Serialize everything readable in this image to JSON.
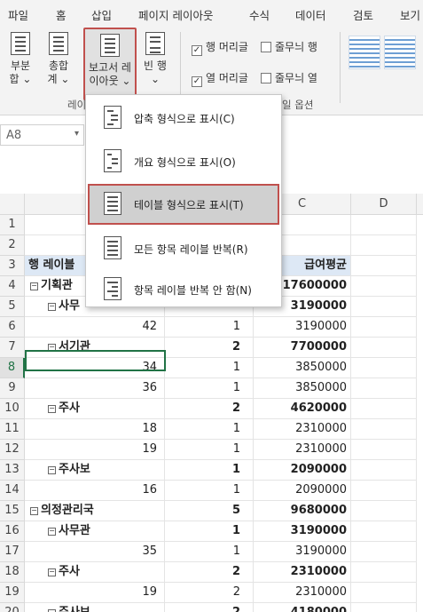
{
  "menubar": {
    "tabs": [
      "파일",
      "홈",
      "삽입",
      "페이지 레이아웃",
      "수식",
      "데이터",
      "검토",
      "보기"
    ]
  },
  "ribbon": {
    "subtotal": {
      "line1": "부분",
      "line2": "합 ⌄"
    },
    "grandtotal": {
      "line1": "총합",
      "line2": "계 ⌄"
    },
    "report_layout": {
      "line1": "보고서 레",
      "line2": "이아웃 ⌄"
    },
    "blank_rows": {
      "line1": "빈 행",
      "line2": "⌄"
    },
    "group_label_layout": "레이",
    "options": {
      "row_headers": "행 머리글",
      "col_headers": "열 머리글",
      "banded_rows": "줄무늬 행",
      "banded_cols": "줄무늬 열",
      "group_label": "일 옵션"
    }
  },
  "namebox": {
    "value": "A8",
    "arrow": "▾"
  },
  "dropdown": {
    "items": [
      "압축 형식으로 표시(C)",
      "개요 형식으로 표시(O)",
      "테이블 형식으로 표시(T)",
      "모든 항목 레이블 반복(R)",
      "항목 레이블 반복 안 함(N)"
    ],
    "highlighted_index": 2
  },
  "grid": {
    "columns": [
      "C",
      "D"
    ],
    "rows": [
      {
        "num": "1",
        "a": "",
        "b": "",
        "c": ""
      },
      {
        "num": "2",
        "a": "",
        "b": "",
        "c": ""
      },
      {
        "num": "3",
        "a": "행 레이블",
        "b": "",
        "c": "급여평균"
      },
      {
        "num": "4",
        "a": "기획관",
        "b": "",
        "c": "17600000"
      },
      {
        "num": "5",
        "a": "사무",
        "b": "",
        "c": "3190000"
      },
      {
        "num": "6",
        "a": "42",
        "b": "1",
        "c": "3190000"
      },
      {
        "num": "7",
        "a": "서기관",
        "b": "2",
        "c": "7700000"
      },
      {
        "num": "8",
        "a": "34",
        "b": "1",
        "c": "3850000"
      },
      {
        "num": "9",
        "a": "36",
        "b": "1",
        "c": "3850000"
      },
      {
        "num": "10",
        "a": "주사",
        "b": "2",
        "c": "4620000"
      },
      {
        "num": "11",
        "a": "18",
        "b": "1",
        "c": "2310000"
      },
      {
        "num": "12",
        "a": "19",
        "b": "1",
        "c": "2310000"
      },
      {
        "num": "13",
        "a": "주사보",
        "b": "1",
        "c": "2090000"
      },
      {
        "num": "14",
        "a": "16",
        "b": "1",
        "c": "2090000"
      },
      {
        "num": "15",
        "a": "의정관리국",
        "b": "5",
        "c": "9680000"
      },
      {
        "num": "16",
        "a": "사무관",
        "b": "1",
        "c": "3190000"
      },
      {
        "num": "17",
        "a": "35",
        "b": "1",
        "c": "3190000"
      },
      {
        "num": "18",
        "a": "주사",
        "b": "2",
        "c": "2310000"
      },
      {
        "num": "19",
        "a": "19",
        "b": "2",
        "c": "2310000"
      },
      {
        "num": "20",
        "a": "주사보",
        "b": "2",
        "c": "4180000"
      }
    ]
  }
}
